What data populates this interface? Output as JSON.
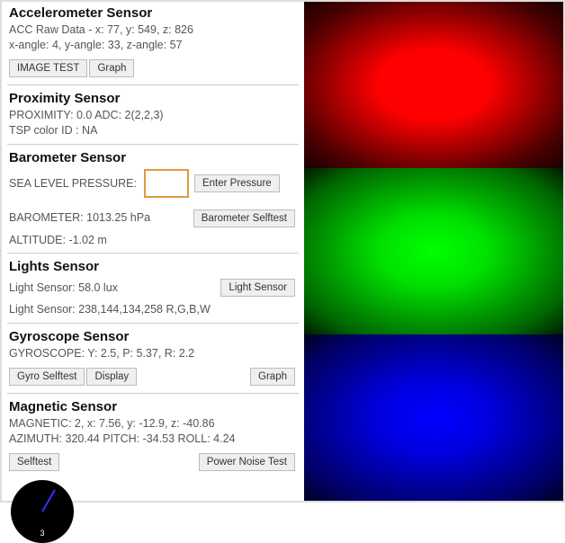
{
  "accelerometer": {
    "title": "Accelerometer Sensor",
    "raw": "ACC Raw Data - x: 77, y: 549, z: 826",
    "angle": "x-angle: 4, y-angle: 33, z-angle: 57",
    "image_test": "IMAGE TEST",
    "graph": "Graph"
  },
  "proximity": {
    "title": "Proximity Sensor",
    "line": "PROXIMITY: 0.0     ADC: 2(2,2,3)",
    "tsp": "TSP color ID : NA"
  },
  "barometer": {
    "title": "Barometer Sensor",
    "sea_label": "SEA LEVEL PRESSURE:",
    "sea_value": "",
    "enter": "Enter Pressure",
    "reading": "BAROMETER: 1013.25 hPa",
    "selftest": "Barometer Selftest",
    "altitude": "ALTITUDE: -1.02 m"
  },
  "lights": {
    "title": "Lights Sensor",
    "lux": "Light Sensor: 58.0 lux",
    "btn": "Light Sensor",
    "rgbw": "Light Sensor: 238,144,134,258 R,G,B,W"
  },
  "gyro": {
    "title": "Gyroscope Sensor",
    "line": "GYROSCOPE: Y: 2.5, P: 5.37, R: 2.2",
    "selftest": "Gyro Selftest",
    "display": "Display",
    "graph": "Graph"
  },
  "magnetic": {
    "title": "Magnetic Sensor",
    "line": "MAGNETIC: 2, x: 7.56, y: -12.9, z: -40.86",
    "orient": "AZIMUTH: 320.44   PITCH: -34.53   ROLL: 4.24",
    "selftest": "Selftest",
    "power": "Power Noise Test",
    "compass_num": "3"
  }
}
